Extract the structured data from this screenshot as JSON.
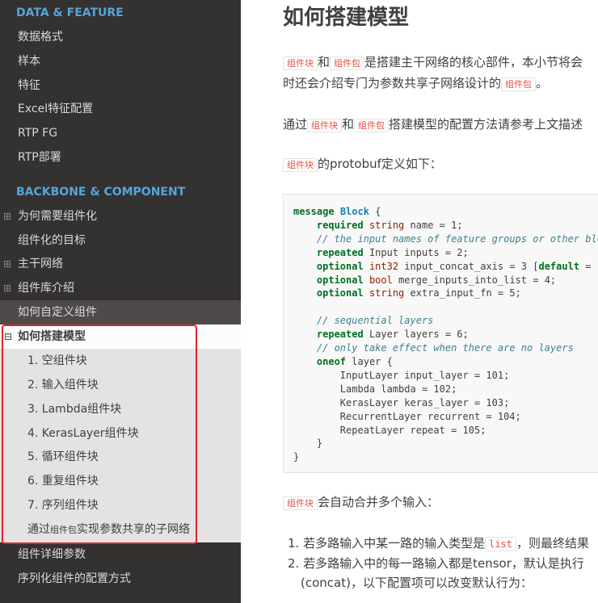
{
  "sidebar": {
    "section1": "DATA & FEATURE",
    "section1_items": [
      "数据格式",
      "样本",
      "特征",
      "Excel特征配置",
      "RTP FG",
      "RTP部署"
    ],
    "section2": "BACKBONE & COMPONENT",
    "section2_items": [
      {
        "label": "为何需要组件化",
        "toggle": "⊞"
      },
      {
        "label": "组件化的目标",
        "toggle": ""
      },
      {
        "label": "主干网络",
        "toggle": "⊞"
      },
      {
        "label": "组件库介绍",
        "toggle": "⊞"
      },
      {
        "label": "如何自定义组件",
        "toggle": ""
      }
    ],
    "current": {
      "label": "如何搭建模型",
      "toggle": "⊟"
    },
    "sub_items": [
      "1. 空组件块",
      "2. 输入组件块",
      "3. Lambda组件块",
      "4. KerasLayer组件块",
      "5. 循环组件块",
      "6. 重复组件块",
      "7. 序列组件块"
    ],
    "last_sub": {
      "prefix": "通过",
      "code": "组件包",
      "suffix": "实现参数共享的子网络"
    },
    "after_items": [
      "组件详细参数",
      "序列化组件的配置方式"
    ]
  },
  "content": {
    "title": "如何搭建模型",
    "p1": {
      "code1": "组件块",
      "t1": "和",
      "code2": "组件包",
      "t2": "是搭建主干网络的核心部件，本小节将会",
      "line2_t1": "时还会介绍专门为参数共享子网络设计的",
      "code3": "组件包",
      "line2_t2": "。"
    },
    "p2": {
      "t1": "通过",
      "code1": "组件块",
      "t2": "和",
      "code2": "组件包",
      "t3": "搭建模型的配置方法请参考上文描述"
    },
    "p3": {
      "code": "组件块",
      "t": "的protobuf定义如下："
    },
    "p4": {
      "code": "组件块",
      "t": "会自动合并多个输入："
    },
    "list": {
      "i1": {
        "t1": "1. 若多路输入中某一路的输入类型是",
        "code": "list",
        "t2": "，则最终结果"
      },
      "i2": "2. 若多路输入中的每一路输入都是tensor，默认是执行",
      "i2b": "(concat)，以下配置项可以改变默认行为："
    }
  },
  "code": {
    "l1": [
      "message",
      "Block",
      "{"
    ],
    "l2": [
      "required",
      "string",
      "name = 1;"
    ],
    "l3": "// the input names of feature groups or other blo",
    "l4": [
      "repeated",
      "Input inputs = 2;"
    ],
    "l5": [
      "optional",
      "int32",
      "input_concat_axis = 3 [",
      "default",
      " = "
    ],
    "l6": [
      "optional",
      "bool",
      "merge_inputs_into_list = 4;"
    ],
    "l7": [
      "optional",
      "string",
      "extra_input_fn = 5;"
    ],
    "l9": "// sequential layers",
    "l10": [
      "repeated",
      "Layer layers = 6;"
    ],
    "l11": "// only take effect when there are no layers",
    "l12": [
      "oneof",
      "layer {"
    ],
    "l13": "InputLayer input_layer = 101;",
    "l14": "Lambda lambda = 102;",
    "l15": "KerasLayer keras_layer = 103;",
    "l16": "RecurrentLayer recurrent = 104;",
    "l17": "RepeatLayer repeat = 105;",
    "l18": "}",
    "l19": "}"
  }
}
